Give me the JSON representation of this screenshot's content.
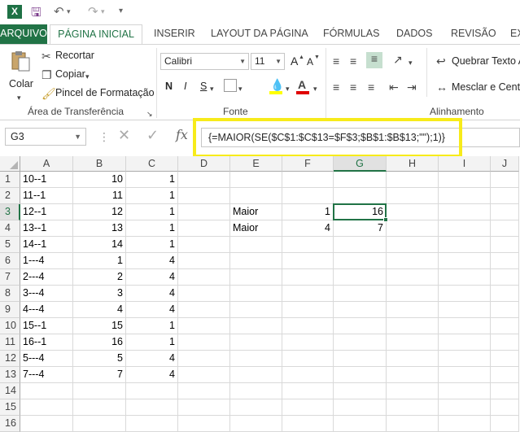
{
  "qat": {
    "logo": "X",
    "icons": [
      "excel-logo",
      "save-icon",
      "undo-icon",
      "redo-icon",
      "customize-icon"
    ]
  },
  "tabs": [
    {
      "label": "ARQUIVO"
    },
    {
      "label": "PÁGINA INICIAL"
    },
    {
      "label": "INSERIR"
    },
    {
      "label": "LAYOUT DA PÁGINA"
    },
    {
      "label": "FÓRMULAS"
    },
    {
      "label": "DADOS"
    },
    {
      "label": "REVISÃO"
    },
    {
      "label": "EX"
    }
  ],
  "ribbon": {
    "clipboard": {
      "paste_label": "Colar",
      "cut_label": "Recortar",
      "copy_label": "Copiar",
      "format_painter_label": "Pincel de Formatação",
      "group_label": "Área de Transferência"
    },
    "font": {
      "font_name": "Calibri",
      "font_size": "11",
      "bold": "N",
      "italic": "I",
      "underline": "S",
      "grow": "A",
      "shrink": "A",
      "group_label": "Fonte"
    },
    "alignment": {
      "wrap_text_label": "Quebrar Texto A",
      "merge_label": "Mesclar e Centra",
      "group_label": "Alinhamento"
    }
  },
  "formula_bar": {
    "name_box": "G3",
    "fx": "fx",
    "formula": "{=MAIOR(SE($C$1:$C$13=$F$3;$B$1:$B$13;\"\");1)}"
  },
  "columns": [
    "A",
    "B",
    "C",
    "D",
    "E",
    "F",
    "G",
    "H",
    "I",
    "J"
  ],
  "selected_column": "G",
  "selected_row": "3",
  "rows": [
    {
      "n": "1",
      "A": "10--1",
      "B": "10",
      "C": "1",
      "E": "",
      "F": "",
      "G": ""
    },
    {
      "n": "2",
      "A": "11--1",
      "B": "11",
      "C": "1",
      "E": "",
      "F": "",
      "G": ""
    },
    {
      "n": "3",
      "A": "12--1",
      "B": "12",
      "C": "1",
      "E": "Maior",
      "F": "1",
      "G": "16"
    },
    {
      "n": "4",
      "A": "13--1",
      "B": "13",
      "C": "1",
      "E": "Maior",
      "F": "4",
      "G": "7"
    },
    {
      "n": "5",
      "A": "14--1",
      "B": "14",
      "C": "1",
      "E": "",
      "F": "",
      "G": ""
    },
    {
      "n": "6",
      "A": "1---4",
      "B": "1",
      "C": "4",
      "E": "",
      "F": "",
      "G": ""
    },
    {
      "n": "7",
      "A": "2---4",
      "B": "2",
      "C": "4",
      "E": "",
      "F": "",
      "G": ""
    },
    {
      "n": "8",
      "A": "3---4",
      "B": "3",
      "C": "4",
      "E": "",
      "F": "",
      "G": ""
    },
    {
      "n": "9",
      "A": "4---4",
      "B": "4",
      "C": "4",
      "E": "",
      "F": "",
      "G": ""
    },
    {
      "n": "10",
      "A": "15--1",
      "B": "15",
      "C": "1",
      "E": "",
      "F": "",
      "G": ""
    },
    {
      "n": "11",
      "A": "16--1",
      "B": "16",
      "C": "1",
      "E": "",
      "F": "",
      "G": ""
    },
    {
      "n": "12",
      "A": "5---4",
      "B": "5",
      "C": "4",
      "E": "",
      "F": "",
      "G": ""
    },
    {
      "n": "13",
      "A": "7---4",
      "B": "7",
      "C": "4",
      "E": "",
      "F": "",
      "G": ""
    },
    {
      "n": "14",
      "A": "",
      "B": "",
      "C": "",
      "E": "",
      "F": "",
      "G": ""
    },
    {
      "n": "15",
      "A": "",
      "B": "",
      "C": "",
      "E": "",
      "F": "",
      "G": ""
    },
    {
      "n": "16",
      "A": "",
      "B": "",
      "C": "",
      "E": "",
      "F": "",
      "G": ""
    }
  ],
  "colors": {
    "excel_green": "#217346",
    "highlight_yellow": "#f7eb1a"
  }
}
